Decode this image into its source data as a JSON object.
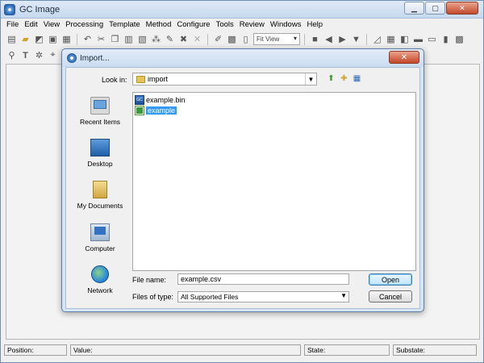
{
  "app": {
    "title": "GC Image"
  },
  "menu": [
    "File",
    "Edit",
    "View",
    "Processing",
    "Template",
    "Method",
    "Configure",
    "Tools",
    "Review",
    "Windows",
    "Help"
  ],
  "toolbar": {
    "view_mode": "Fit View"
  },
  "status": {
    "position": "Position:",
    "value": "Value:",
    "state": "State:",
    "substate": "Substate:"
  },
  "dialog": {
    "title": "Import...",
    "look_in_label": "Look in:",
    "look_in_value": "import",
    "places": [
      "Recent Items",
      "Desktop",
      "My Documents",
      "Computer",
      "Network"
    ],
    "files": [
      {
        "name": "example.bin",
        "icon": "bin-file-icon",
        "selected": false
      },
      {
        "name": "example",
        "icon": "csv-file-icon",
        "selected": true
      }
    ],
    "file_name_label": "File name:",
    "file_name_value": "example.csv",
    "file_type_label": "Files of type:",
    "file_type_value": "All Supported Files",
    "open_label": "Open",
    "cancel_label": "Cancel"
  }
}
